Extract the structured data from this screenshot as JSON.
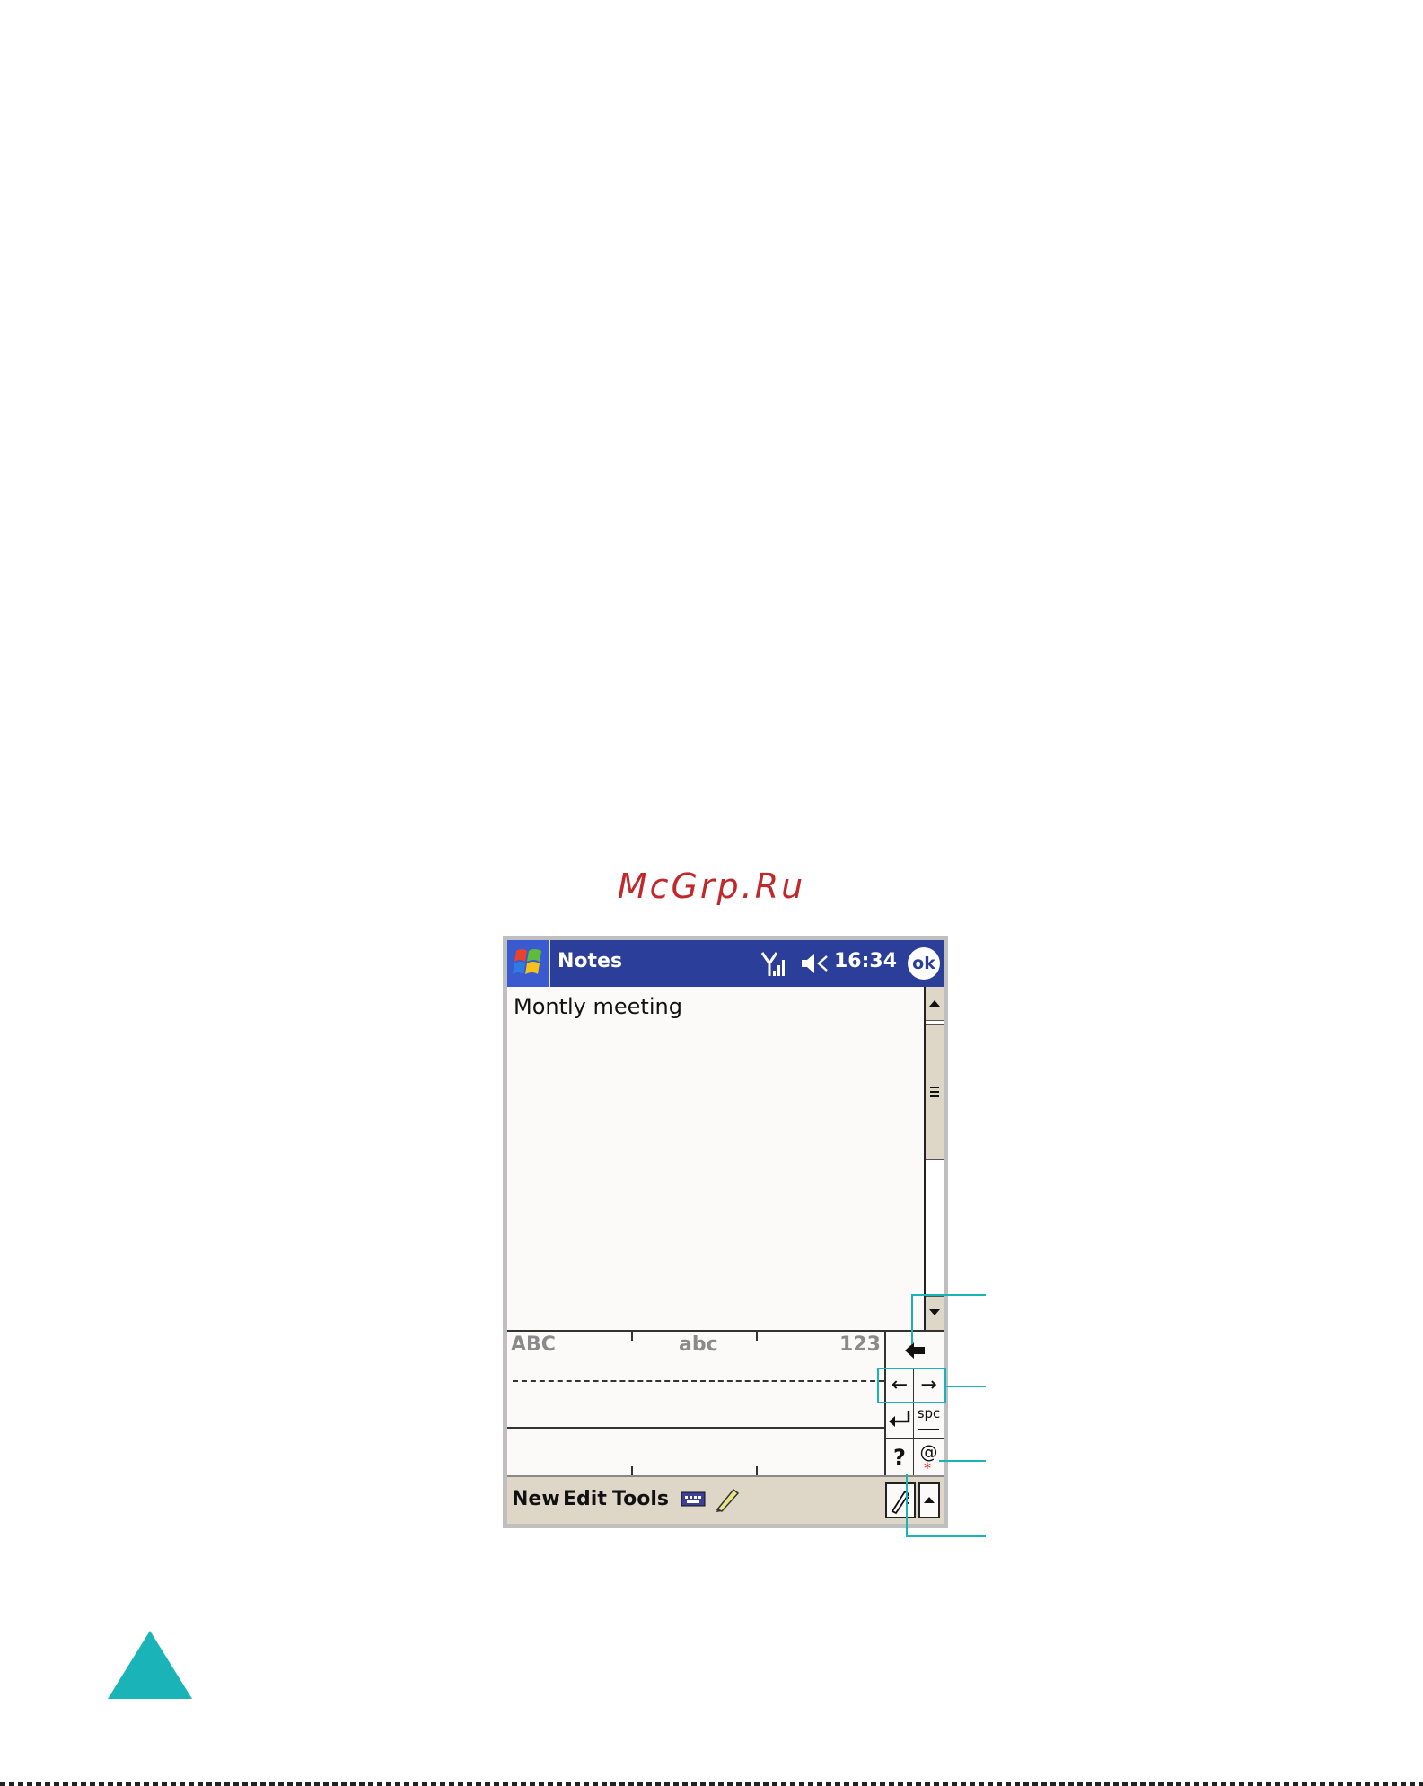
{
  "watermark": "McGrp.Ru",
  "titlebar": {
    "app_title": "Notes",
    "time": "16:34",
    "ok_label": "ok",
    "start_icon": "windows-flag-icon",
    "signal_icon": "signal-strength-icon",
    "sound_icon": "speaker-muted-icon"
  },
  "note": {
    "text": "Montly meeting"
  },
  "input_panel": {
    "label_upper": "ABC",
    "label_lower": "abc",
    "label_numbers": "123",
    "backspace_icon": "backspace-arrow-icon",
    "left_arrow": "←",
    "right_arrow": "→",
    "enter_icon": "enter-icon",
    "space_label": "spc",
    "help_label": "?",
    "symbol_label": "@",
    "symbol_mark": "*"
  },
  "menubar": {
    "items": [
      "New",
      "Edit",
      "Tools"
    ],
    "keyboard_icon": "keyboard-icon",
    "pen_icon": "pen-icon",
    "sip_icon": "input-selector-icon"
  },
  "colors": {
    "title_bar": "#2b3f9a",
    "callout": "#1ab3b8",
    "watermark": "#c0282c",
    "menu_bar": "#ded6c6"
  }
}
